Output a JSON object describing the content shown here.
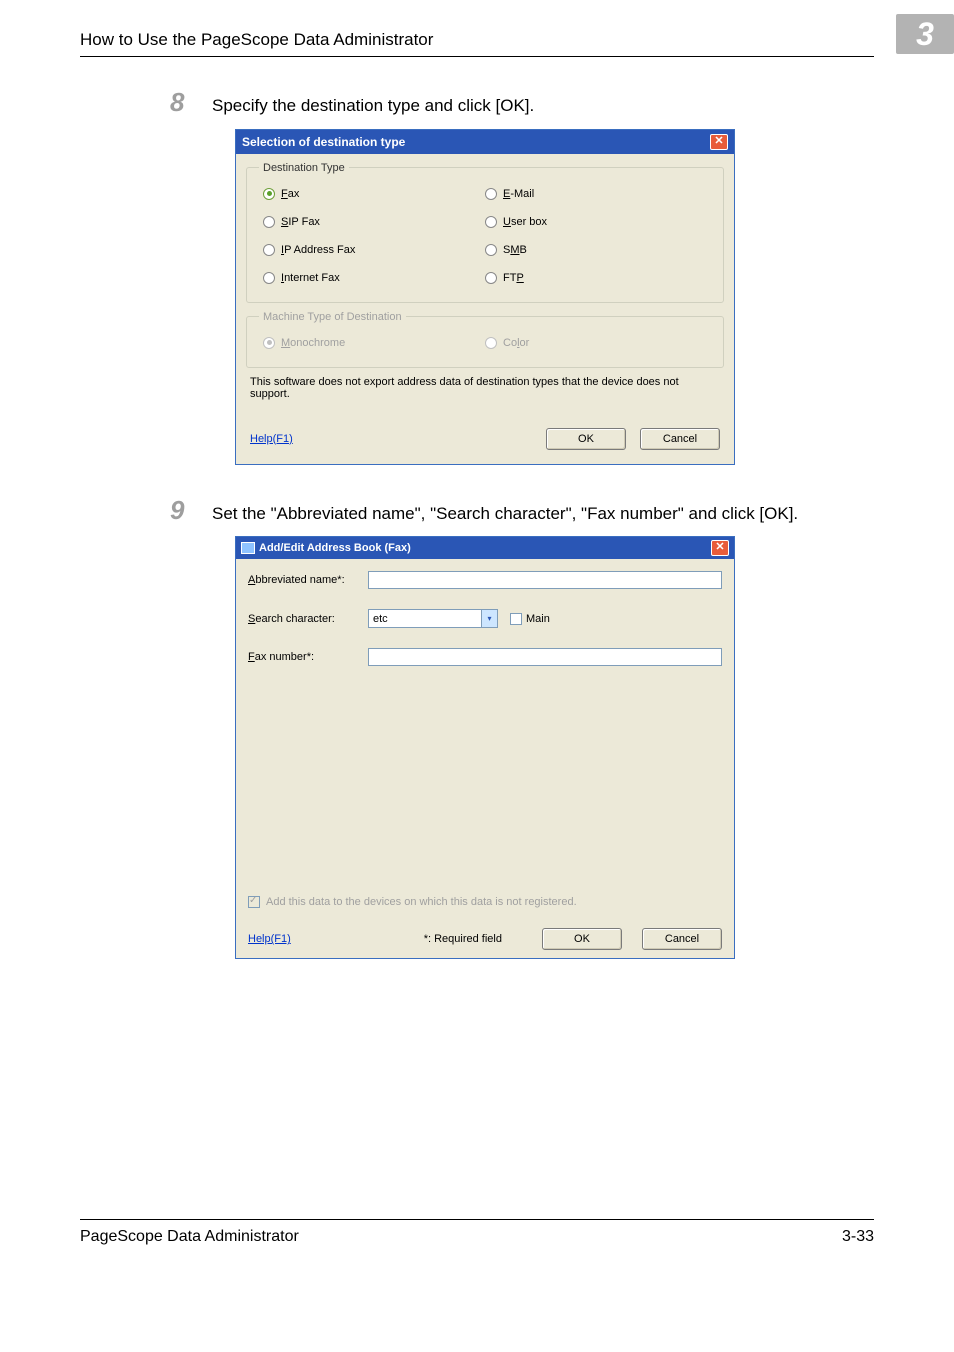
{
  "header": {
    "title": "How to Use the PageScope Data Administrator",
    "chapter": "3"
  },
  "step8": {
    "num": "8",
    "text": "Specify the destination type and click [OK]."
  },
  "dlg1": {
    "title": "Selection of destination type",
    "group1_legend": "Destination Type",
    "fax": "ax",
    "email": "-Mail",
    "sip": "IP Fax",
    "userbox": "ser box",
    "ipaddr": "P Address Fax",
    "smb": "S",
    "smb2": "B",
    "internet": "nternet Fax",
    "ftp": "FT",
    "group2_legend": "Machine Type of Destination",
    "mono": "onochrome",
    "color": "Co",
    "color2": "or",
    "note": "This software does not export address data of destination types that the device does not support.",
    "help": "Help(F1)",
    "ok": "OK",
    "cancel": "Cancel"
  },
  "step9": {
    "num": "9",
    "text": "Set the \"Abbreviated name\", \"Search character\", \"Fax number\" and click [OK]."
  },
  "dlg2": {
    "title": "Add/Edit  Address Book (Fax)",
    "abbrev": "bbreviated name*:",
    "search": "earch character:",
    "search_val": "etc",
    "main": "ain",
    "faxnum": "ax number*:",
    "addnote": "Add this data to the devices on which this data is not registered.",
    "help": "Help(F1)",
    "req": "*: Required field",
    "ok": "OK",
    "cancel": "Cancel"
  },
  "footer": {
    "left": "PageScope Data Administrator",
    "right": "3-33"
  }
}
